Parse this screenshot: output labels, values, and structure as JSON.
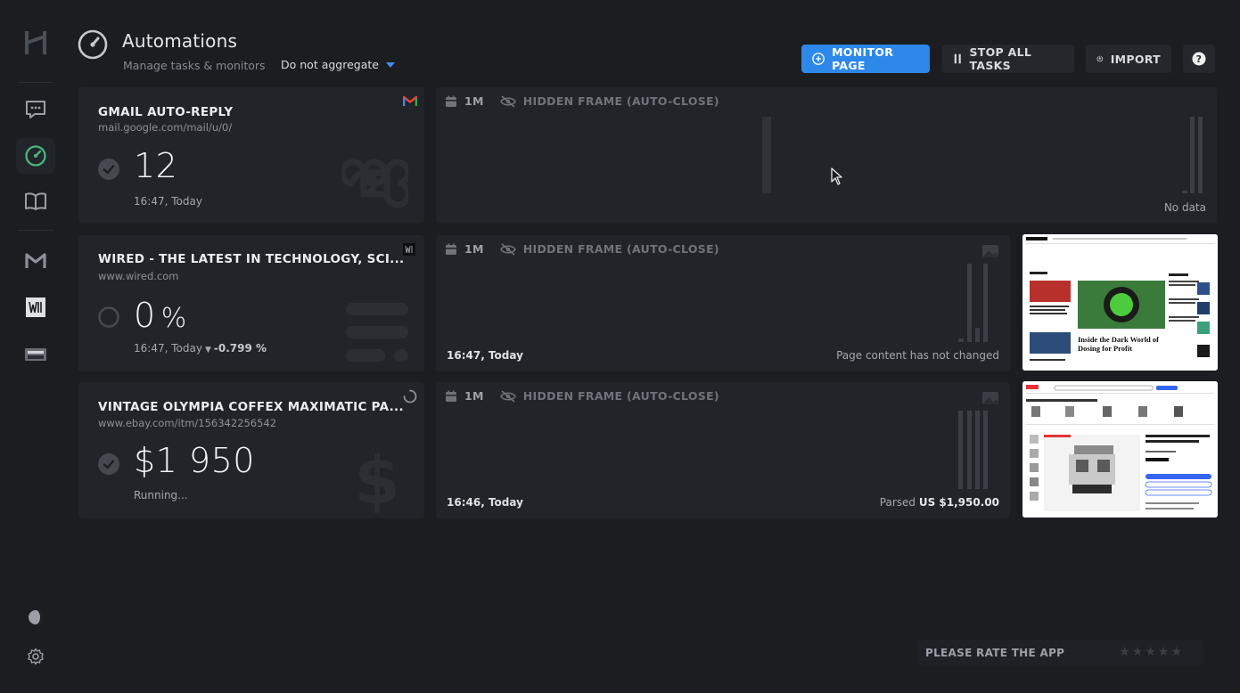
{
  "header": {
    "title": "Automations",
    "subtitle": "Manage tasks & monitors",
    "aggregate_select": "Do not aggregate"
  },
  "toolbar": {
    "monitor_label": "MONITOR PAGE",
    "stop_label": "STOP ALL TASKS",
    "import_label": "IMPORT"
  },
  "sidebar": {
    "items": [
      {
        "icon": "logo-icon"
      },
      {
        "icon": "chat-icon"
      },
      {
        "icon": "speedometer-icon",
        "active": true
      },
      {
        "icon": "book-icon"
      },
      {
        "icon": "gmail-m-icon"
      },
      {
        "icon": "wired-icon"
      },
      {
        "icon": "ebay-item-icon"
      },
      {
        "icon": "theme-icon"
      },
      {
        "icon": "settings-icon"
      }
    ]
  },
  "tasks": [
    {
      "title": "GMAIL AUTO-REPLY",
      "url": "mail.google.com/mail/u/0/",
      "value": "12",
      "time": "16:47, Today",
      "chart": {
        "period": "1M",
        "mode": "HIDDEN FRAME (AUTO-CLOSE)",
        "status": "No data"
      }
    },
    {
      "title": "WIRED - THE LATEST IN TECHNOLOGY, SCI...",
      "url": "www.wired.com",
      "value": "0",
      "unit": "%",
      "time": "16:47, Today",
      "delta": "-0.799 %",
      "chart": {
        "period": "1M",
        "mode": "HIDDEN FRAME (AUTO-CLOSE)",
        "time": "16:47, Today",
        "status": "Page content has not changed"
      }
    },
    {
      "title": "VINTAGE OLYMPIA COFFEX MAXIMATIC PA...",
      "url": "www.ebay.com/itm/156342256542",
      "value": "$1 950",
      "time": "Running...",
      "chart": {
        "period": "1M",
        "mode": "HIDDEN FRAME (AUTO-CLOSE)",
        "time": "16:46, Today",
        "status_prefix": "Parsed",
        "status_value": "US $1,950.00"
      }
    }
  ],
  "thumbnails": {
    "wired": {
      "headline": "Inside the Dark World of Dosing for Profit"
    }
  },
  "rating": {
    "label": "PLEASE RATE THE APP",
    "stars": 5,
    "filled": 0
  },
  "colors": {
    "accent": "#2d88ea",
    "background": "#1b1d21",
    "card": "#212428",
    "success": "#4cb782"
  }
}
